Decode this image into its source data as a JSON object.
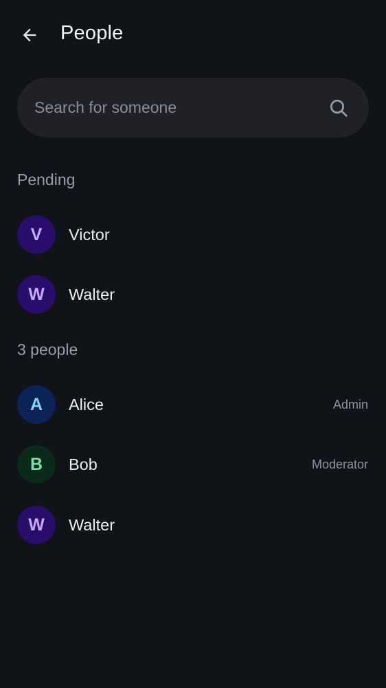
{
  "header": {
    "title": "People"
  },
  "search": {
    "placeholder": "Search for someone",
    "value": ""
  },
  "sections": [
    {
      "label": "Pending",
      "members": [
        {
          "initial": "V",
          "name": "Victor",
          "role": "",
          "avatar_bg": "#2a0c6b",
          "avatar_fg": "#c3a9ff"
        },
        {
          "initial": "W",
          "name": "Walter",
          "role": "",
          "avatar_bg": "#2a0c6b",
          "avatar_fg": "#c3a9ff"
        }
      ]
    },
    {
      "label": "3 people",
      "members": [
        {
          "initial": "A",
          "name": "Alice",
          "role": "Admin",
          "avatar_bg": "#0b2357",
          "avatar_fg": "#7fd4f0"
        },
        {
          "initial": "B",
          "name": "Bob",
          "role": "Moderator",
          "avatar_bg": "#0b2a1a",
          "avatar_fg": "#7fdca8"
        },
        {
          "initial": "W",
          "name": "Walter",
          "role": "",
          "avatar_bg": "#2a0c6b",
          "avatar_fg": "#c3a9ff"
        }
      ]
    }
  ],
  "icons": {
    "back": "arrow-left-icon",
    "search": "search-icon"
  }
}
